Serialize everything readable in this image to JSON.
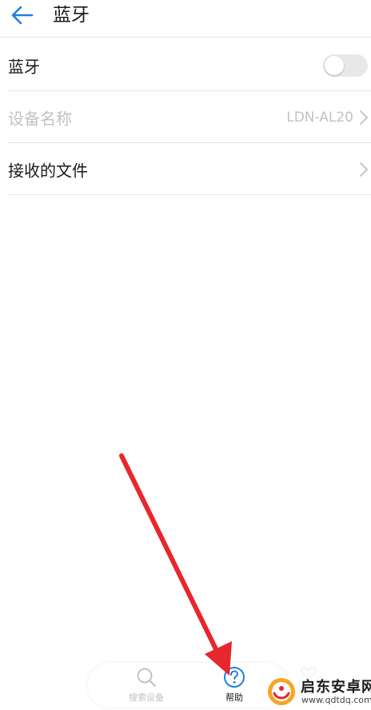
{
  "header": {
    "title": "蓝牙",
    "back_icon": "arrow-left-icon"
  },
  "settings": {
    "bluetooth": {
      "label": "蓝牙",
      "enabled": false
    },
    "device_name": {
      "label": "设备名称",
      "value": "LDN-AL20",
      "disabled": true
    },
    "received_files": {
      "label": "接收的文件"
    }
  },
  "bottom_bar": {
    "search": {
      "label": "搜索设备",
      "icon": "search-icon",
      "disabled": true
    },
    "help": {
      "label": "帮助",
      "icon": "help-icon"
    }
  },
  "watermark": {
    "title": "启东安卓网",
    "url": "www.qdtdq.com"
  },
  "colors": {
    "accent": "#1e7fe0",
    "arrow": "#e8262d",
    "disabled_text": "#c2c2c2"
  }
}
